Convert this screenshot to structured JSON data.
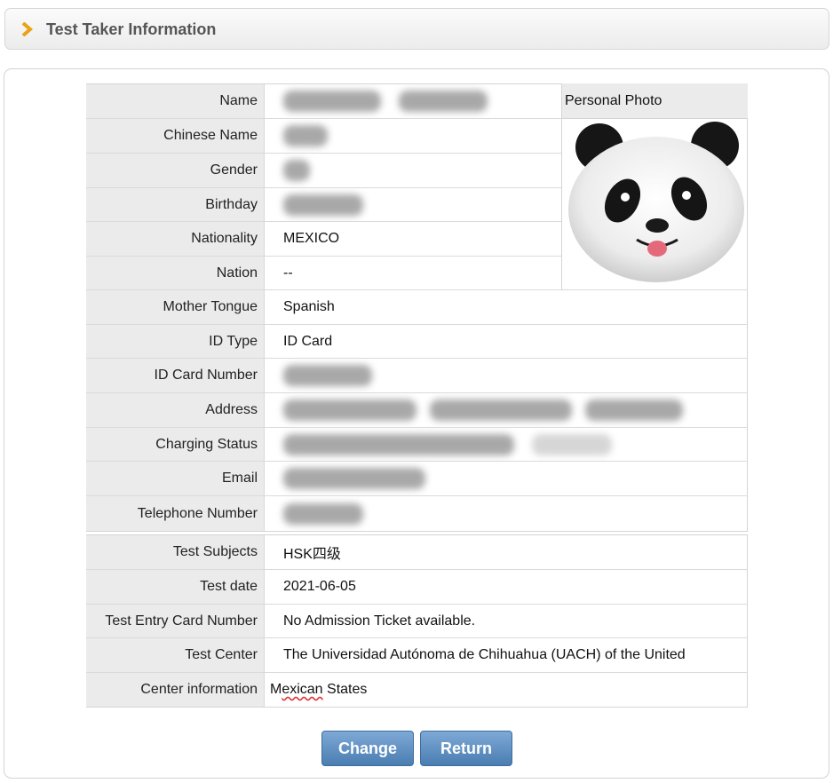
{
  "header": {
    "title": "Test Taker Information"
  },
  "photo": {
    "label": "Personal Photo",
    "image": "panda-face"
  },
  "personal_rows": [
    {
      "label": "Name",
      "value": ""
    },
    {
      "label": "Chinese Name",
      "value": ""
    },
    {
      "label": "Gender",
      "value": ""
    },
    {
      "label": "Birthday",
      "value": ""
    },
    {
      "label": "Nationality",
      "value": "MEXICO"
    },
    {
      "label": "Nation",
      "value": "--"
    },
    {
      "label": "Mother Tongue",
      "value": "Spanish"
    },
    {
      "label": "ID Type",
      "value": "ID Card"
    },
    {
      "label": "ID Card Number",
      "value": ""
    },
    {
      "label": "Address",
      "value": ""
    },
    {
      "label": "Charging Status",
      "value": ""
    },
    {
      "label": "Email",
      "value": ""
    },
    {
      "label": "Telephone Number",
      "value": ""
    }
  ],
  "test_rows": [
    {
      "label": "Test Subjects",
      "value": "HSK四级"
    },
    {
      "label": "Test date",
      "value": "2021-06-05"
    },
    {
      "label": "Test Entry Card Number",
      "value": "No Admission Ticket available."
    },
    {
      "label": "Test Center",
      "value": "The Universidad Autónoma de Chihuahua (UACH) of the United"
    },
    {
      "label": "Center information",
      "value_prefix": "M",
      "value_misspelled": "exican",
      "value_suffix": " States"
    }
  ],
  "buttons": {
    "change": "Change",
    "return": "Return"
  },
  "colors": {
    "button_blue": "#4a7db1",
    "label_bg": "#ebebeb",
    "chevron": "#e8a317"
  }
}
